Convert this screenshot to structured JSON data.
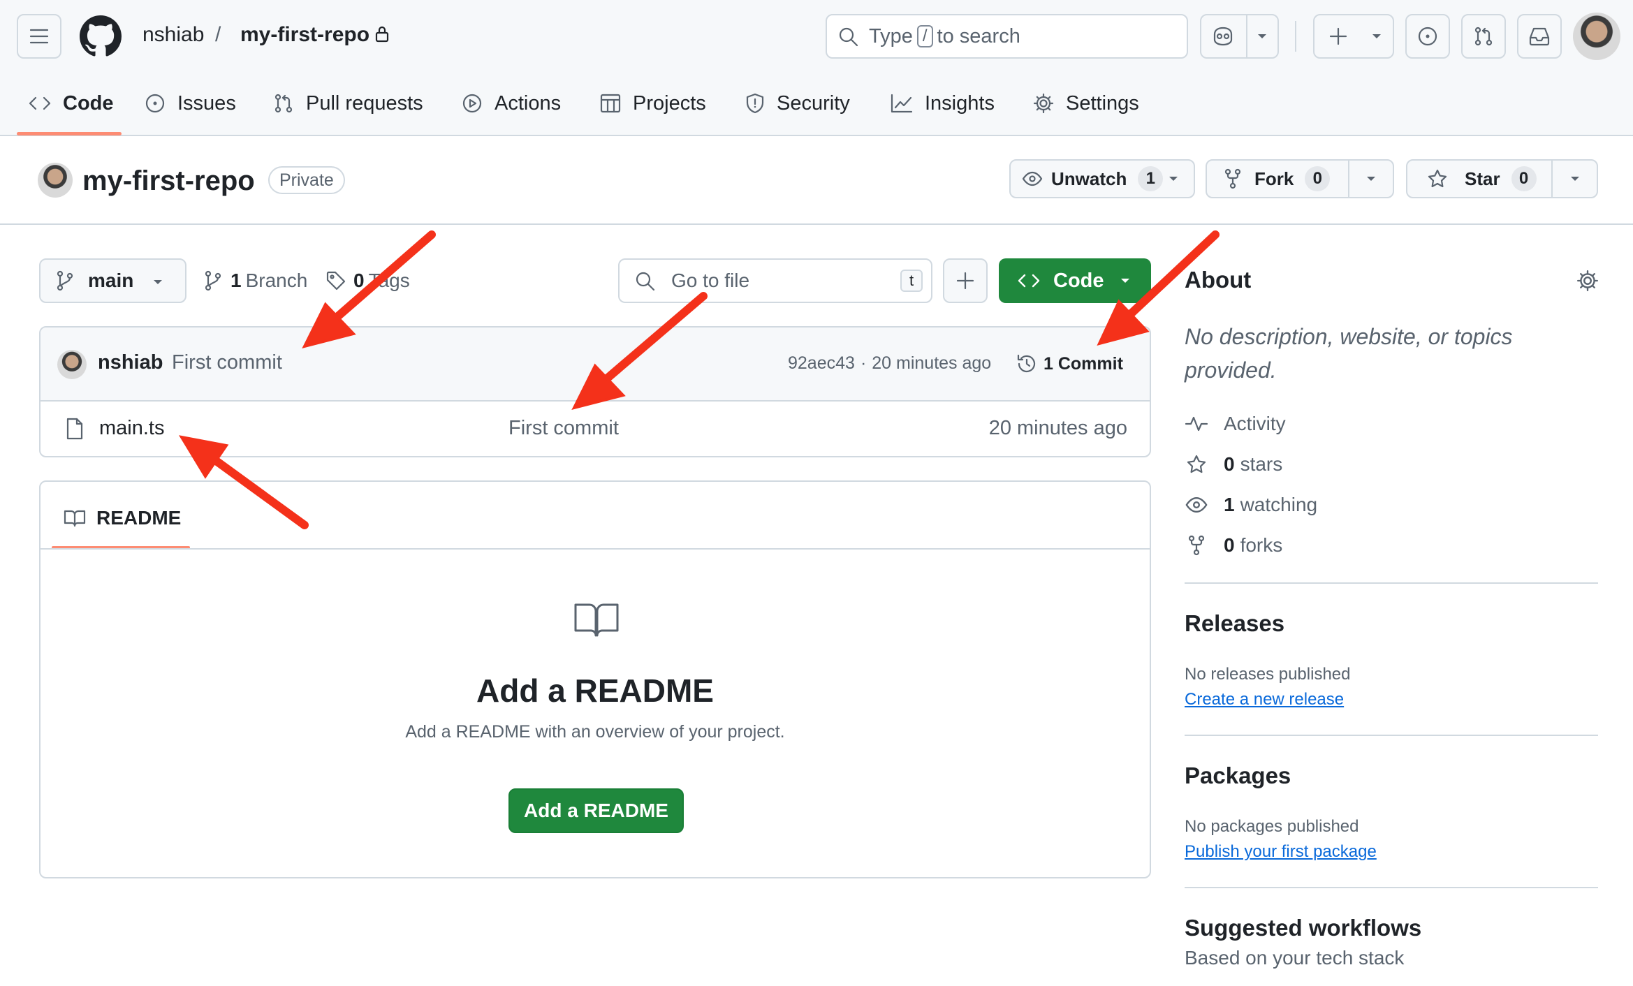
{
  "header": {
    "owner": "nshiab",
    "separator": "/",
    "repo": "my-first-repo",
    "search": {
      "prefix": "Type",
      "key": "/",
      "suffix": "to search"
    }
  },
  "tabs": [
    {
      "label": "Code",
      "active": true
    },
    {
      "label": "Issues"
    },
    {
      "label": "Pull requests"
    },
    {
      "label": "Actions"
    },
    {
      "label": "Projects"
    },
    {
      "label": "Security"
    },
    {
      "label": "Insights"
    },
    {
      "label": "Settings"
    }
  ],
  "repo": {
    "name": "my-first-repo",
    "visibility": "Private",
    "unwatch_label": "Unwatch",
    "unwatch_count": "1",
    "fork_label": "Fork",
    "fork_count": "0",
    "star_label": "Star",
    "star_count": "0"
  },
  "toolbar": {
    "branch": "main",
    "branches_count": "1",
    "branches_label": "Branch",
    "tags_count": "0",
    "tags_label": "Tags",
    "goto_placeholder": "Go to file",
    "goto_key": "t",
    "code_label": "Code"
  },
  "commit": {
    "author": "nshiab",
    "message": "First commit",
    "hash": "92aec43",
    "dot": "·",
    "time": "20 minutes ago",
    "count_label": "1 Commit"
  },
  "files": [
    {
      "name": "main.ts",
      "message": "First commit",
      "time": "20 minutes ago"
    }
  ],
  "readme": {
    "tab_label": "README",
    "title": "Add a README",
    "description": "Add a README with an overview of your project.",
    "button": "Add a README"
  },
  "sidebar": {
    "about_title": "About",
    "about_desc": "No description, website, or topics provided.",
    "activity": "Activity",
    "stars_count": "0",
    "stars_label": "stars",
    "watching_count": "1",
    "watching_label": "watching",
    "forks_count": "0",
    "forks_label": "forks",
    "releases_title": "Releases",
    "releases_empty": "No releases published",
    "releases_link": "Create a new release",
    "packages_title": "Packages",
    "packages_empty": "No packages published",
    "packages_link": "Publish your first package",
    "workflows_title": "Suggested workflows",
    "workflows_sub": "Based on your tech stack"
  },
  "colors": {
    "accent_green": "#1f883d",
    "link_blue": "#0969da",
    "tab_underline": "#fd8c73",
    "annotation_arrow": "#f4311a"
  }
}
